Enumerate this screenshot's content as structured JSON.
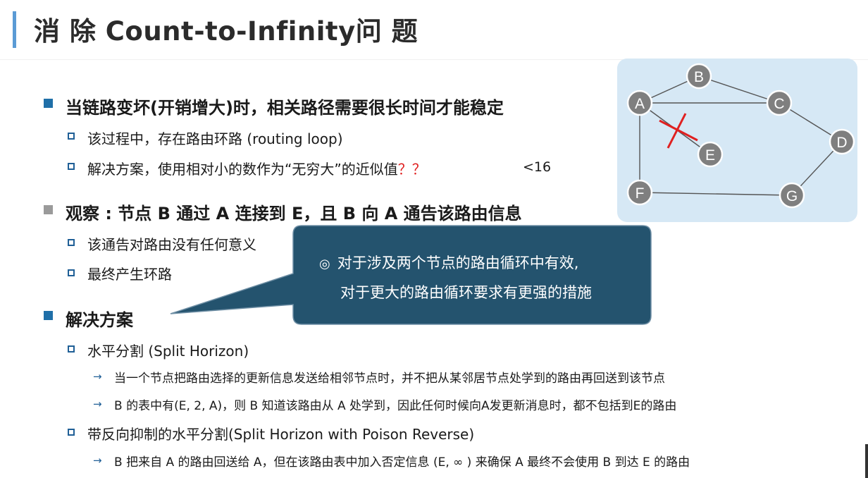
{
  "title": "消 除 Count-to-Infinity问 题",
  "points": [
    {
      "text": "当链路变坏(开销增大)时，相关路径需要很长时间才能稳定",
      "bullet_color": "#1f6fa8"
    },
    {
      "text": "观察 : 节点 B 通过 A 连接到 E，且 B 向 A 通告该路由信息",
      "bullet_color": "#9a9a9a"
    },
    {
      "text": "解决方案",
      "bullet_color": "#1f6fa8"
    }
  ],
  "subpoints": {
    "routing_loop": "该过程中，存在路由环路 (routing loop)",
    "solution_prefix": "解决方案，使用相对小的数作为“无穷大”的近似值",
    "question_marks": "？？",
    "limit": "<16",
    "meaningless": "该通告对路由没有任何意义",
    "loop_result": "最终产生环路",
    "split_horizon": "水平分割 (Split Horizon)",
    "poison_reverse": "带反向抑制的水平分割(Split Horizon with Poison Reverse)"
  },
  "details": {
    "arrow": "→",
    "sh_1": "当一个节点把路由选择的更新信息发送给相邻节点时，并不把从某邻居节点处学到的路由再回送到该节点",
    "sh_2": "B 的表中有(E, 2, A)，则 B 知道该路由从 A 处学到，因此任何时候向A发更新消息时，都不包括到E的路由",
    "pr_1": "B 把来自 A 的路由回送给 A，但在该路由表中加入否定信息 (E, ∞ ) 来确保 A 最终不会使用 B 到达 E 的路由"
  },
  "callout": {
    "icon": "◎",
    "line1": "对于涉及两个节点的路由循环中有效,",
    "line2": "对于更大的路由循环要求有更强的措施",
    "bg_color": "#24536e"
  },
  "graph": {
    "nodes": [
      "A",
      "B",
      "C",
      "D",
      "E",
      "F",
      "G"
    ],
    "edges": [
      [
        "A",
        "B"
      ],
      [
        "A",
        "C"
      ],
      [
        "B",
        "C"
      ],
      [
        "C",
        "D"
      ],
      [
        "D",
        "G"
      ],
      [
        "F",
        "G"
      ],
      [
        "A",
        "F"
      ],
      [
        "A",
        "E"
      ]
    ],
    "broken_link": [
      "A",
      "E"
    ],
    "node_color": "#7f7f7f",
    "cross_color": "#e02020"
  }
}
